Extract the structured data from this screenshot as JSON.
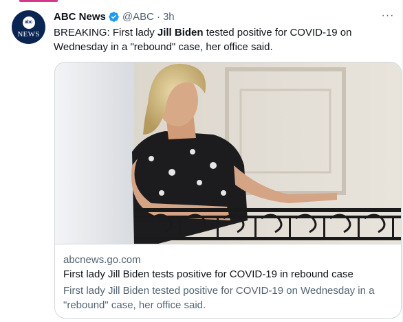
{
  "tweet": {
    "author_name": "ABC News",
    "handle": "@ABC",
    "separator": "·",
    "time": "3h",
    "avatar_logo_text": "abc",
    "avatar_text": "NEWS",
    "more_label": "···",
    "text_prefix": "BREAKING: First lady ",
    "text_bold": "Jill Biden",
    "text_suffix": " tested positive for COVID-19 on Wednesday in a \"rebound\" case, her office said."
  },
  "card": {
    "domain": "abcnews.go.com",
    "title": "First lady Jill Biden tests positive for COVID-19 in rebound case",
    "description": "First lady Jill Biden tested positive for COVID-19 on Wednesday in a \"rebound\" case, her office said."
  },
  "colors": {
    "verified": "#1d9bf0",
    "accent_pink": "#d6368b",
    "avatar_bg": "#0b2552"
  },
  "icons": [
    "verified-badge-icon",
    "more-icon"
  ]
}
